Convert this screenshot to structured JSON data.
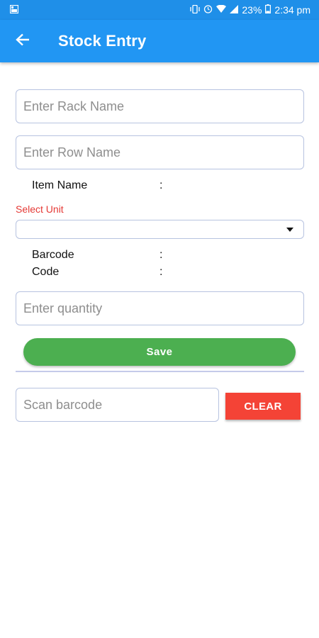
{
  "status_bar": {
    "battery_percent": "23%",
    "time": "2:34 pm",
    "icons": [
      "image-icon",
      "vibrate-icon",
      "alarm-icon",
      "wifi-icon",
      "signal-icon",
      "battery-icon"
    ]
  },
  "app_bar": {
    "title": "Stock Entry",
    "back_icon": "arrow-left-icon"
  },
  "form": {
    "rack_name_placeholder": "Enter Rack Name",
    "row_name_placeholder": "Enter Row Name",
    "item_name_label": "Item Name",
    "colon": ":",
    "select_unit_label": "Select Unit",
    "select_unit_value": "",
    "barcode_label": "Barcode",
    "code_label": "Code",
    "quantity_placeholder": "Enter quantity",
    "save_label": "Save"
  },
  "scan": {
    "scan_placeholder": "Scan barcode",
    "clear_label": "CLEAR"
  },
  "colors": {
    "app_bar": "#2196f3",
    "status_bar": "#1f8fe8",
    "save_button": "#4caf50",
    "clear_button": "#f44336",
    "select_unit_label": "#e53935",
    "field_border": "#b7c3e0"
  }
}
